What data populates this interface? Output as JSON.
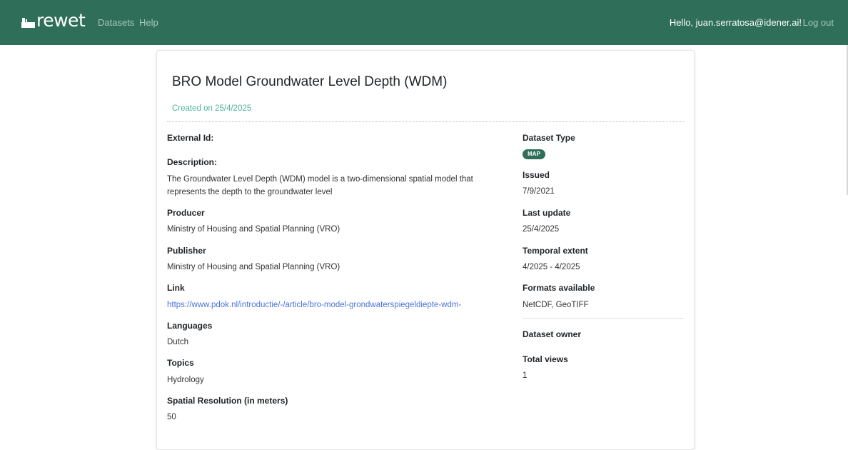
{
  "navbar": {
    "brand": "rewet",
    "links": [
      "Datasets",
      "Help"
    ],
    "greeting": "Hello, juan.serratosa@idener.ai!",
    "logout": "Log out",
    "color": "#2f6f5a"
  },
  "dataset": {
    "title": "BRO Model Groundwater Level Depth (WDM)",
    "created": "Created on 25/4/2025",
    "left": {
      "external_id_label": "External Id:",
      "description_label": "Description:",
      "description": "The Groundwater Level Depth (WDM) model is a two-dimensional spatial model that represents the depth to the groundwater level",
      "producer_label": "Producer",
      "producer": "Ministry of Housing and Spatial Planning (VRO)",
      "publisher_label": "Publisher",
      "publisher": "Ministry of Housing and Spatial Planning (VRO)",
      "link_label": "Link",
      "link": "https://www.pdok.nl/introductie/-/article/bro-model-grondwaterspiegeldiepte-wdm-",
      "languages_label": "Languages",
      "languages": "Dutch",
      "topics_label": "Topics",
      "topics": "Hydrology",
      "resolution_label": "Spatial Resolution (in meters)",
      "resolution": "50"
    },
    "right": {
      "type_label": "Dataset Type",
      "type_badge": "MAP",
      "issued_label": "Issued",
      "issued": "7/9/2021",
      "last_update_label": "Last update",
      "last_update": "25/4/2025",
      "temporal_label": "Temporal extent",
      "temporal": "4/2025 - 4/2025",
      "formats_label": "Formats available",
      "formats": "NetCDF, GeoTIFF",
      "owner_label": "Dataset owner",
      "views_label": "Total views",
      "views": "1"
    }
  }
}
